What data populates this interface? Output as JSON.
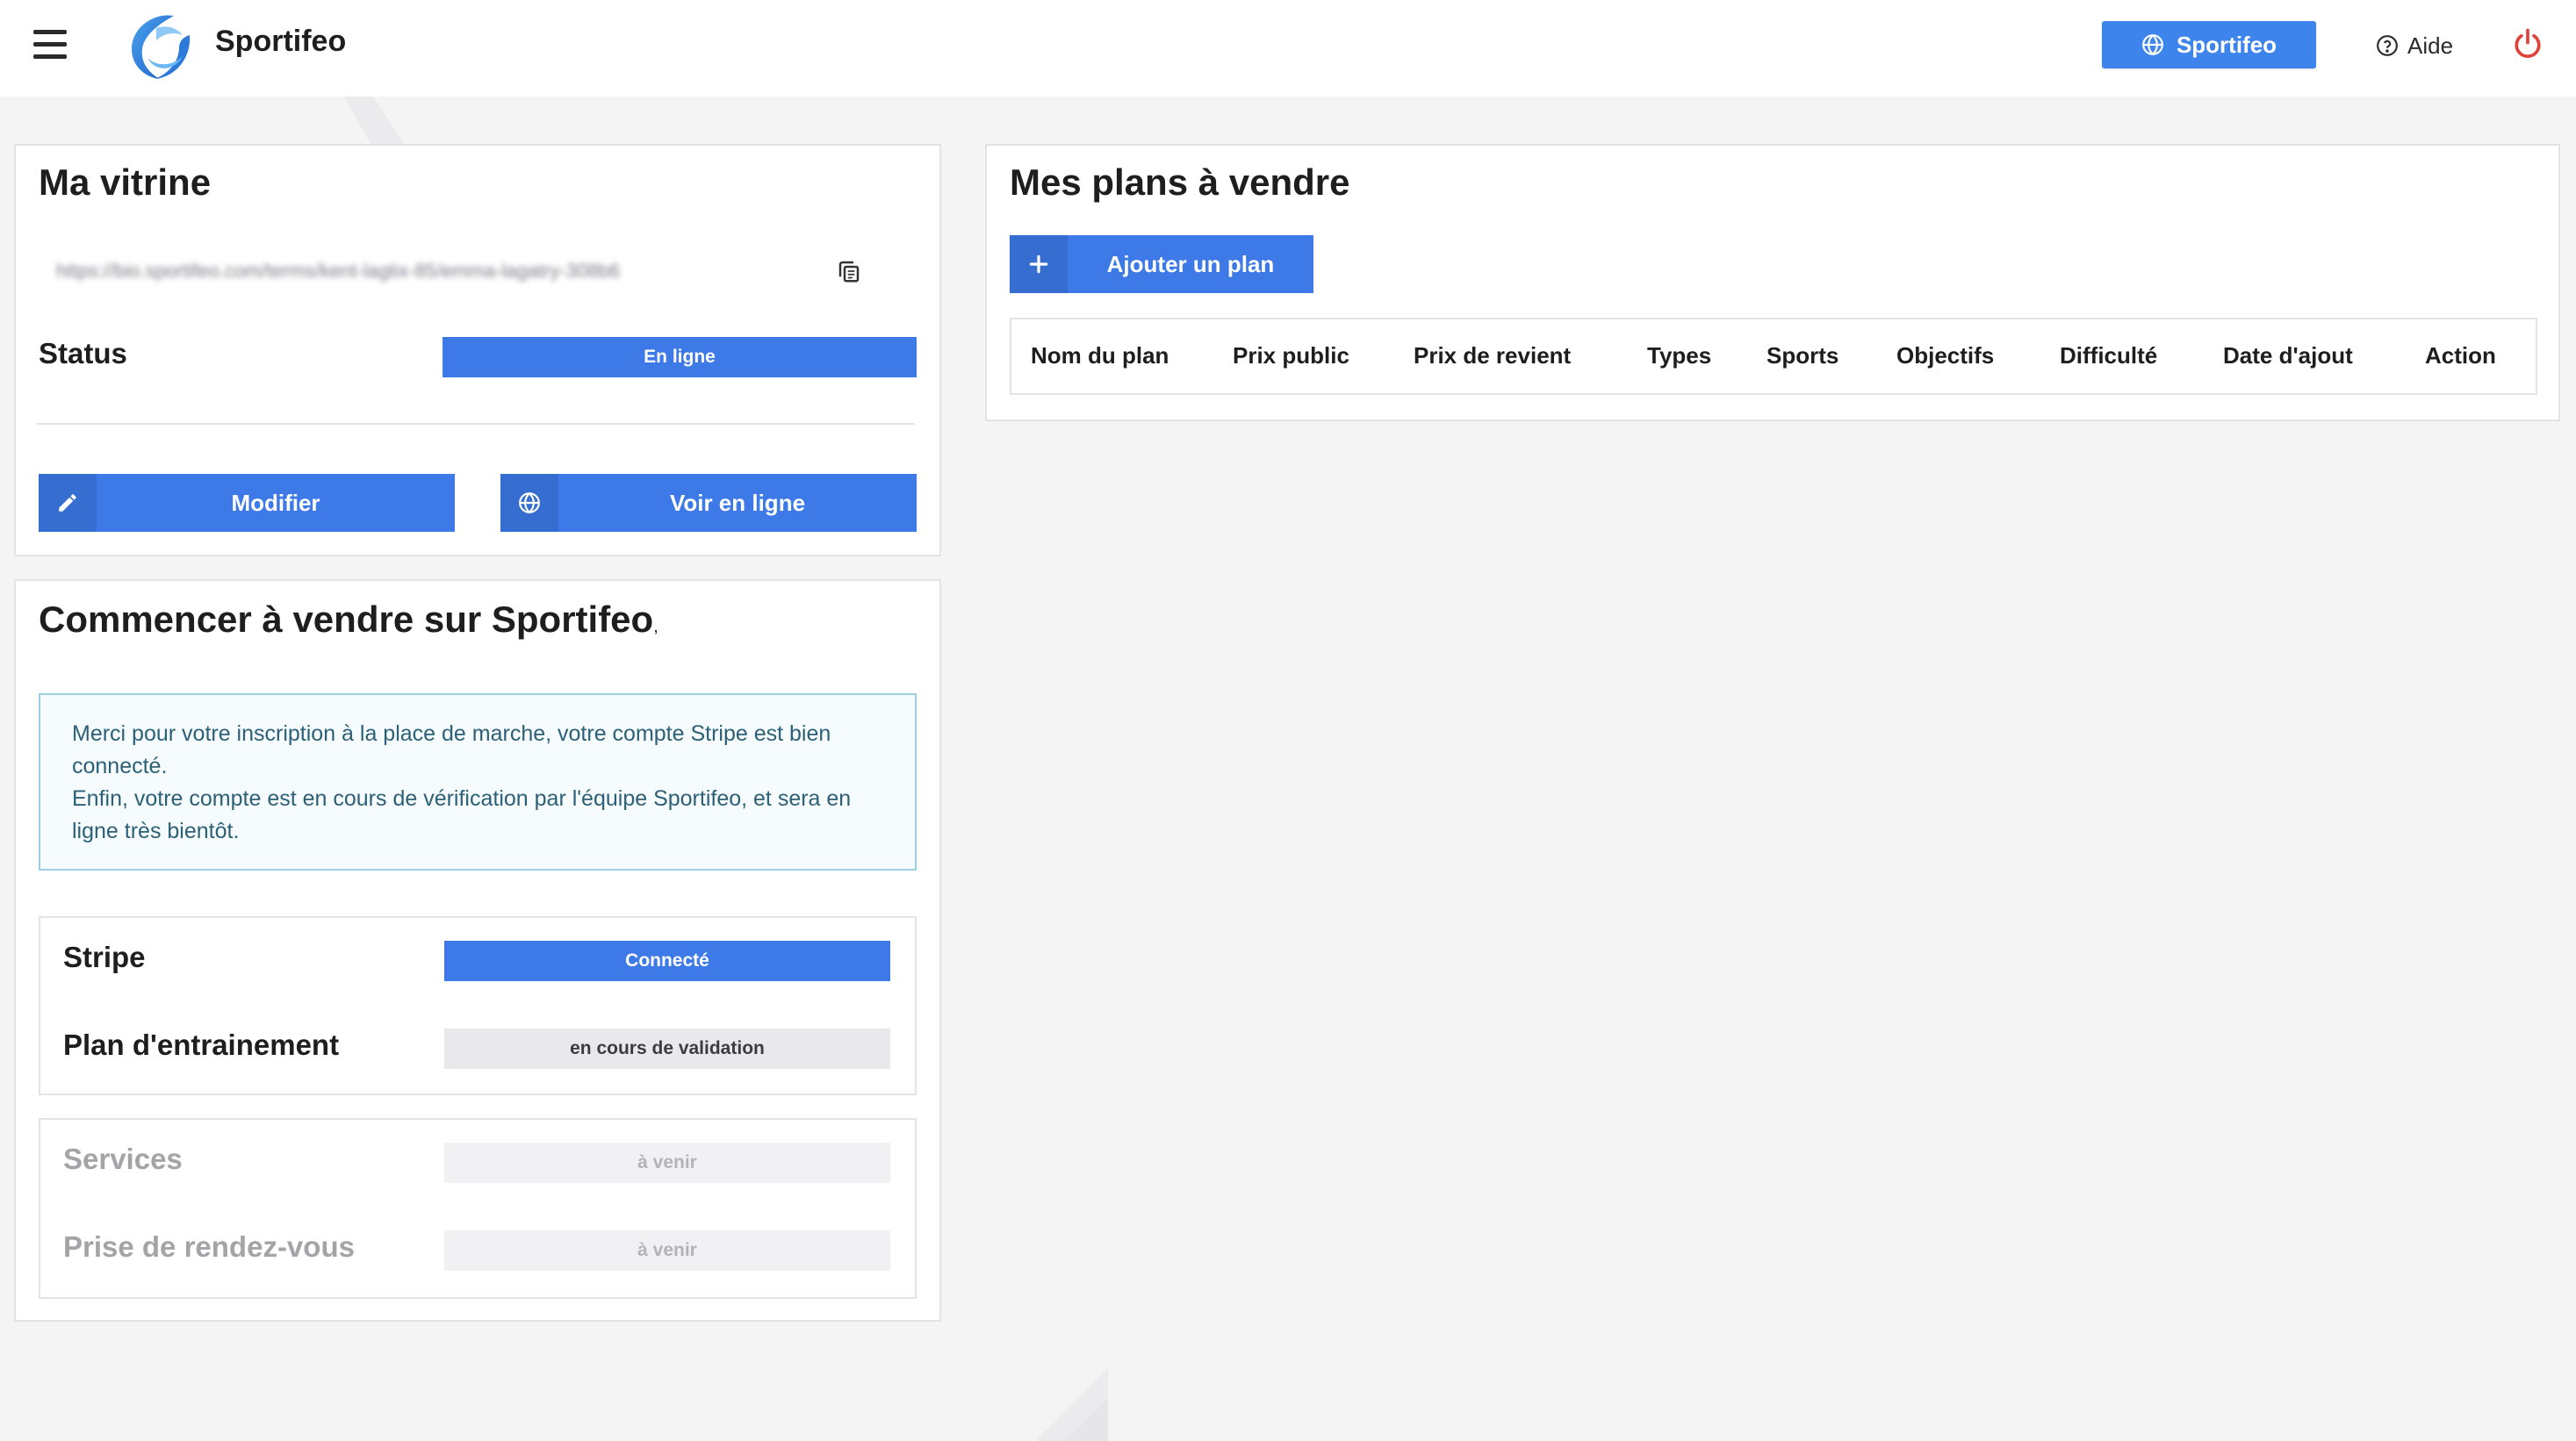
{
  "header": {
    "brand": "Sportifeo",
    "top_button": "Sportifeo",
    "help": "Aide",
    "icons": {
      "menu": "hamburger-icon",
      "globe": "globe-icon",
      "help": "question-circle-icon",
      "power": "power-icon"
    }
  },
  "vitrine": {
    "title": "Ma vitrine",
    "url": "https://bio.sportifeo.com/terms/kent-lagtix-85/emma-lagatry-308b6",
    "status_label": "Status",
    "status_value": "En ligne",
    "edit_button": "Modifier",
    "view_button": "Voir en ligne"
  },
  "sell": {
    "title": "Commencer à vendre sur Sportifeo",
    "title_suffix": ",",
    "info_line1": "Merci pour votre inscription à la place de marche, votre compte Stripe est bien connecté.",
    "info_line2": "Enfin, votre compte est en cours de vérification par l'équipe Sportifeo, et sera en ligne très bientôt.",
    "stripe_label": "Stripe",
    "stripe_value": "Connecté",
    "plan_label": "Plan d'entrainement",
    "plan_value": "en cours de validation",
    "services_label": "Services",
    "services_value": "à venir",
    "rdv_label": "Prise de rendez-vous",
    "rdv_value": "à venir"
  },
  "plans": {
    "title": "Mes plans à vendre",
    "add_button": "Ajouter un plan",
    "columns": [
      "Nom du plan",
      "Prix public",
      "Prix de revient",
      "Types",
      "Sports",
      "Objectifs",
      "Difficulté",
      "Date d'ajout",
      "Action"
    ]
  },
  "colors": {
    "primary": "#3d7ae8",
    "top_button": "#3d85ec",
    "power": "#e0413a",
    "info_border": "#9ccfe0",
    "info_text": "#2c6077"
  }
}
